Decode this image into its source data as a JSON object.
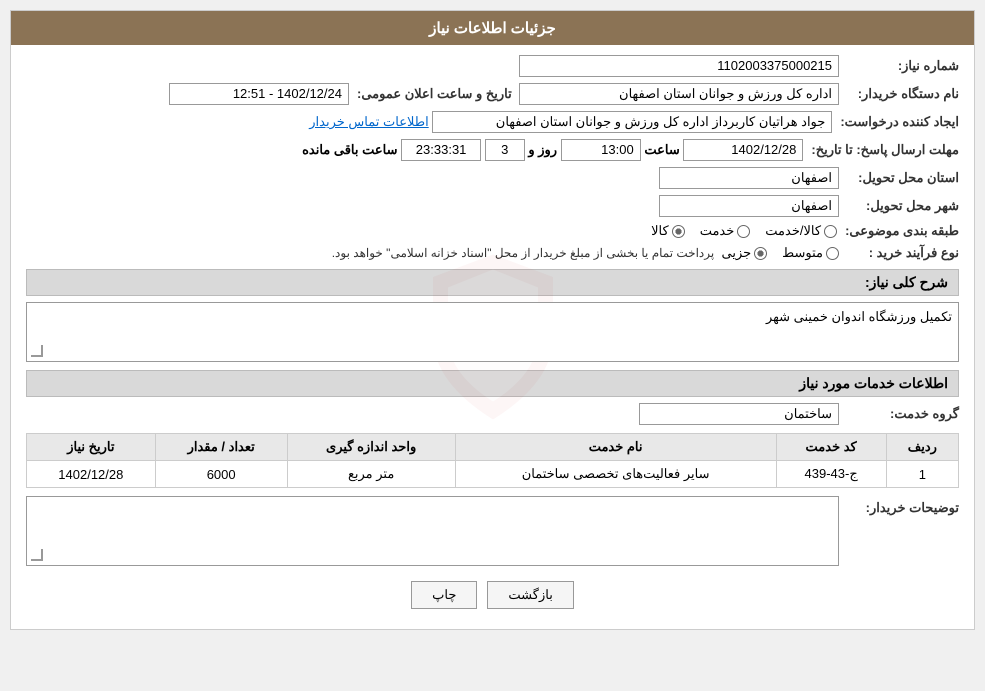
{
  "header": {
    "title": "جزئیات اطلاعات نیاز"
  },
  "fields": {
    "need_number_label": "شماره نیاز:",
    "need_number_value": "1102003375000215",
    "org_name_label": "نام دستگاه خریدار:",
    "org_name_value": "اداره کل ورزش و جوانان استان اصفهان",
    "announce_date_label": "تاریخ و ساعت اعلان عمومی:",
    "announce_date_value": "1402/12/24 - 12:51",
    "creator_label": "ایجاد کننده درخواست:",
    "creator_value": "جواد هراتیان کاربرداز اداره کل ورزش و جوانان استان اصفهان",
    "contact_link": "اطلاعات تماس خریدار",
    "deadline_label": "مهلت ارسال پاسخ: تا تاریخ:",
    "deadline_date": "1402/12/28",
    "deadline_time_label": "ساعت",
    "deadline_time": "13:00",
    "deadline_day_label": "روز و",
    "deadline_days": "3",
    "deadline_remain_label": "ساعت باقی مانده",
    "deadline_remain": "23:33:31",
    "province_label": "استان محل تحویل:",
    "province_value": "اصفهان",
    "city_label": "شهر محل تحویل:",
    "city_value": "اصفهان",
    "category_label": "طبقه بندی موضوعی:",
    "radio_kala": "کالا",
    "radio_khedmat": "خدمت",
    "radio_kala_khedmat": "کالا/خدمت",
    "purchase_type_label": "نوع فرآیند خرید :",
    "purchase_radio_jozi": "جزیی",
    "purchase_radio_motavasset": "متوسط",
    "purchase_info": "پرداخت تمام یا بخشی از مبلغ خریدار از محل \"اسناد خزانه اسلامی\" خواهد بود.",
    "need_desc_label": "شرح کلی نیاز:",
    "need_desc_value": "تکمیل ورزشگاه اندوان خمینی شهر",
    "services_info_title": "اطلاعات خدمات مورد نیاز",
    "service_group_label": "گروه خدمت:",
    "service_group_value": "ساختمان",
    "table_headers": {
      "radif": "ردیف",
      "code": "کد خدمت",
      "name": "نام خدمت",
      "unit": "واحد اندازه گیری",
      "count": "تعداد / مقدار",
      "date": "تاریخ نیاز"
    },
    "table_rows": [
      {
        "radif": "1",
        "code": "ج-43-439",
        "name": "سایر فعالیت‌های تخصصی ساختمان",
        "unit": "متر مربع",
        "count": "6000",
        "date": "1402/12/28"
      }
    ],
    "buyer_desc_label": "توضیحات خریدار:"
  },
  "buttons": {
    "print": "چاپ",
    "back": "بازگشت"
  }
}
